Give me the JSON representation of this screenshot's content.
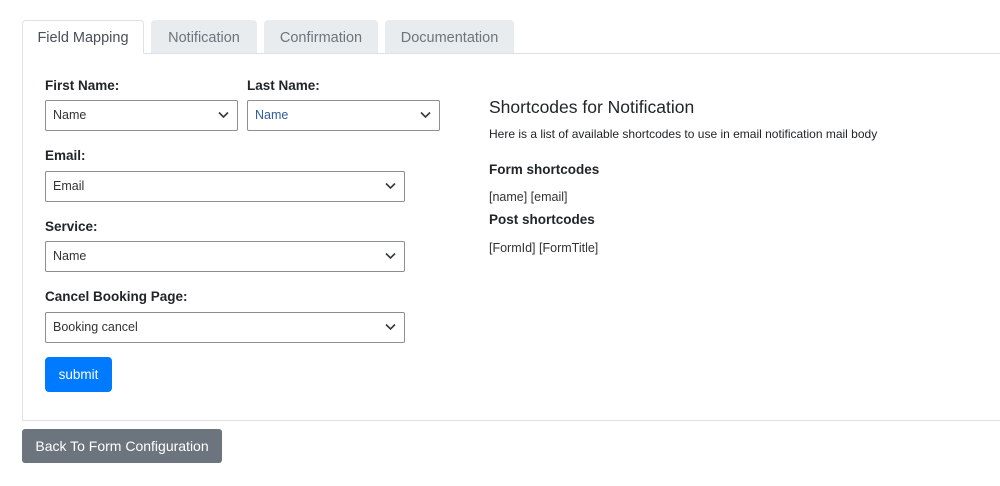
{
  "tabs": [
    {
      "label": "Field Mapping",
      "active": true
    },
    {
      "label": "Notification",
      "active": false
    },
    {
      "label": "Confirmation",
      "active": false
    },
    {
      "label": "Documentation",
      "active": false
    }
  ],
  "form": {
    "first_name": {
      "label": "First Name:",
      "value": "Name"
    },
    "last_name": {
      "label": "Last Name:",
      "value": "Name"
    },
    "email": {
      "label": "Email:",
      "value": "Email"
    },
    "service": {
      "label": "Service:",
      "value": "Name"
    },
    "cancel_page": {
      "label": "Cancel Booking Page:",
      "value": "Booking cancel"
    },
    "submit_label": "submit"
  },
  "shortcodes": {
    "title": "Shortcodes for Notification",
    "description": "Here is a list of available shortcodes to use in email notification mail body",
    "form_heading": "Form shortcodes",
    "form_codes": "[name] [email]",
    "post_heading": "Post shortcodes",
    "post_codes": "[FormId] [FormTitle]"
  },
  "back_button": "Back To Form Configuration",
  "icons": {
    "select_arrow": "chevron-down-icon"
  },
  "colors": {
    "primary": "#007bff",
    "secondary": "#6c757d",
    "tab_inactive_bg": "#e9ecef",
    "last_name_value": "#2e5d9a"
  }
}
